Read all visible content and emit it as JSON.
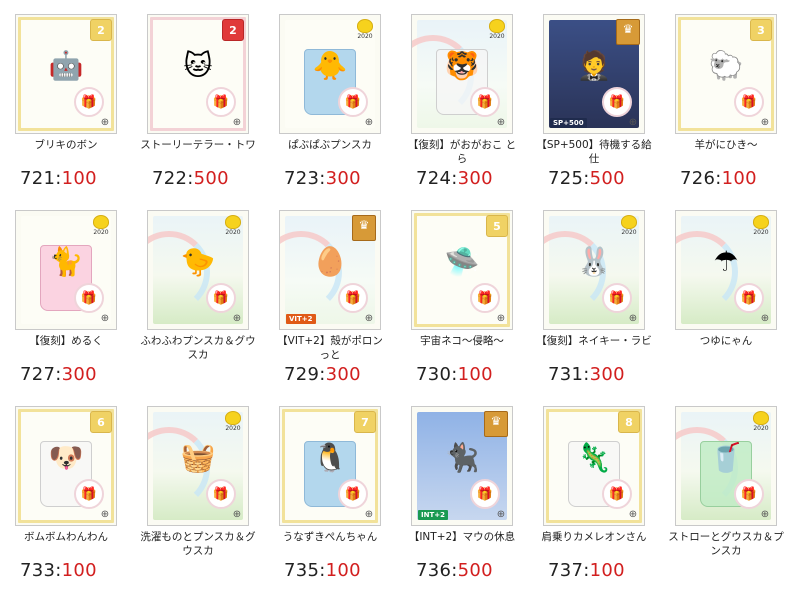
{
  "items": [
    {
      "name": "ブリキのボン",
      "num": "721",
      "val": "100",
      "badge": {
        "type": "num",
        "text": "2"
      },
      "bg": "plain",
      "frame": "gold",
      "jar": "",
      "art": "🤖",
      "tag": ""
    },
    {
      "name": "ストーリーテラー・トワ",
      "num": "722",
      "val": "500",
      "badge": {
        "type": "numred",
        "text": "2"
      },
      "bg": "plain",
      "frame": "pink",
      "jar": "",
      "art": "🐱",
      "tag": ""
    },
    {
      "name": "ぱぶぱぶプンスカ",
      "num": "723",
      "val": "300",
      "badge": {
        "type": "chick",
        "text": "2020"
      },
      "bg": "plain",
      "frame": "none",
      "jar": "blue",
      "art": "🐥",
      "tag": ""
    },
    {
      "name": "【復刻】がおがおこ とら",
      "num": "724",
      "val": "300",
      "badge": {
        "type": "chick",
        "text": "2020"
      },
      "bg": "sky",
      "frame": "none",
      "jar": "clear",
      "art": "🐯",
      "tag": ""
    },
    {
      "name": "【SP+500】待機する給仕",
      "num": "725",
      "val": "500",
      "badge": {
        "type": "crown",
        "text": "♛"
      },
      "bg": "dark",
      "frame": "none",
      "jar": "",
      "art": "🤵",
      "tag": "SP+500",
      "tagclass": "sp"
    },
    {
      "name": "羊がにひき〜",
      "num": "726",
      "val": "100",
      "badge": {
        "type": "num",
        "text": "3"
      },
      "bg": "plain",
      "frame": "gold",
      "jar": "",
      "art": "🐑",
      "tag": ""
    },
    {
      "name": "【復刻】めるく",
      "num": "727",
      "val": "300",
      "badge": {
        "type": "chick",
        "text": "2020"
      },
      "bg": "plain",
      "frame": "none",
      "jar": "pink",
      "art": "🐈",
      "tag": ""
    },
    {
      "name": "ふわふわプンスカ＆グウスカ",
      "num": "",
      "val": "",
      "badge": {
        "type": "chick",
        "text": "2020"
      },
      "bg": "hills",
      "frame": "none",
      "jar": "",
      "art": "🐤",
      "tag": ""
    },
    {
      "name": "【VIT+2】殻がポロンっと",
      "num": "729",
      "val": "300",
      "badge": {
        "type": "crown",
        "text": "♛"
      },
      "bg": "sky",
      "frame": "none",
      "jar": "",
      "art": "🥚",
      "tag": "VIT+2",
      "tagclass": "vit"
    },
    {
      "name": "宇宙ネコ〜侵略〜",
      "num": "730",
      "val": "100",
      "badge": {
        "type": "num",
        "text": "5"
      },
      "bg": "plain",
      "frame": "gold",
      "jar": "",
      "art": "🛸",
      "tag": ""
    },
    {
      "name": "【復刻】ネイキー・ラビ",
      "num": "731",
      "val": "300",
      "badge": {
        "type": "chick",
        "text": "2020"
      },
      "bg": "hills",
      "frame": "none",
      "jar": "",
      "art": "🐰",
      "tag": ""
    },
    {
      "name": "つゆにゃん",
      "num": "",
      "val": "",
      "badge": {
        "type": "chick",
        "text": "2020"
      },
      "bg": "hills",
      "frame": "none",
      "jar": "",
      "art": "☂",
      "tag": ""
    },
    {
      "name": "ボムボムわんわん",
      "num": "733",
      "val": "100",
      "badge": {
        "type": "num",
        "text": "6"
      },
      "bg": "plain",
      "frame": "gold",
      "jar": "clear",
      "art": "🐶",
      "tag": ""
    },
    {
      "name": "洗濯ものとプンスカ＆グウスカ",
      "num": "",
      "val": "",
      "badge": {
        "type": "chick",
        "text": "2020"
      },
      "bg": "hills",
      "frame": "none",
      "jar": "",
      "art": "🧺",
      "tag": ""
    },
    {
      "name": "うなずきぺんちゃん",
      "num": "735",
      "val": "100",
      "badge": {
        "type": "num",
        "text": "7"
      },
      "bg": "plain",
      "frame": "gold",
      "jar": "blue",
      "art": "🐧",
      "tag": ""
    },
    {
      "name": "【INT+2】マウの休息",
      "num": "736",
      "val": "500",
      "badge": {
        "type": "crown",
        "text": "♛"
      },
      "bg": "night",
      "frame": "none",
      "jar": "",
      "art": "🐈‍⬛",
      "tag": "INT+2",
      "tagclass": "int"
    },
    {
      "name": "肩乗りカメレオンさん",
      "num": "737",
      "val": "100",
      "badge": {
        "type": "num",
        "text": "8"
      },
      "bg": "plain",
      "frame": "gold",
      "jar": "clear",
      "art": "🦎",
      "tag": ""
    },
    {
      "name": "ストローとグウスカ＆プンスカ",
      "num": "",
      "val": "",
      "badge": {
        "type": "chick",
        "text": "2020"
      },
      "bg": "hills",
      "frame": "none",
      "jar": "green",
      "art": "🥤",
      "tag": ""
    }
  ],
  "icons": {
    "gift": "gift-icon",
    "zoom": "zoom-icon"
  },
  "colors": {
    "value": "#d21f1f",
    "number": "#222222",
    "card_border": "#c9c9c9"
  }
}
